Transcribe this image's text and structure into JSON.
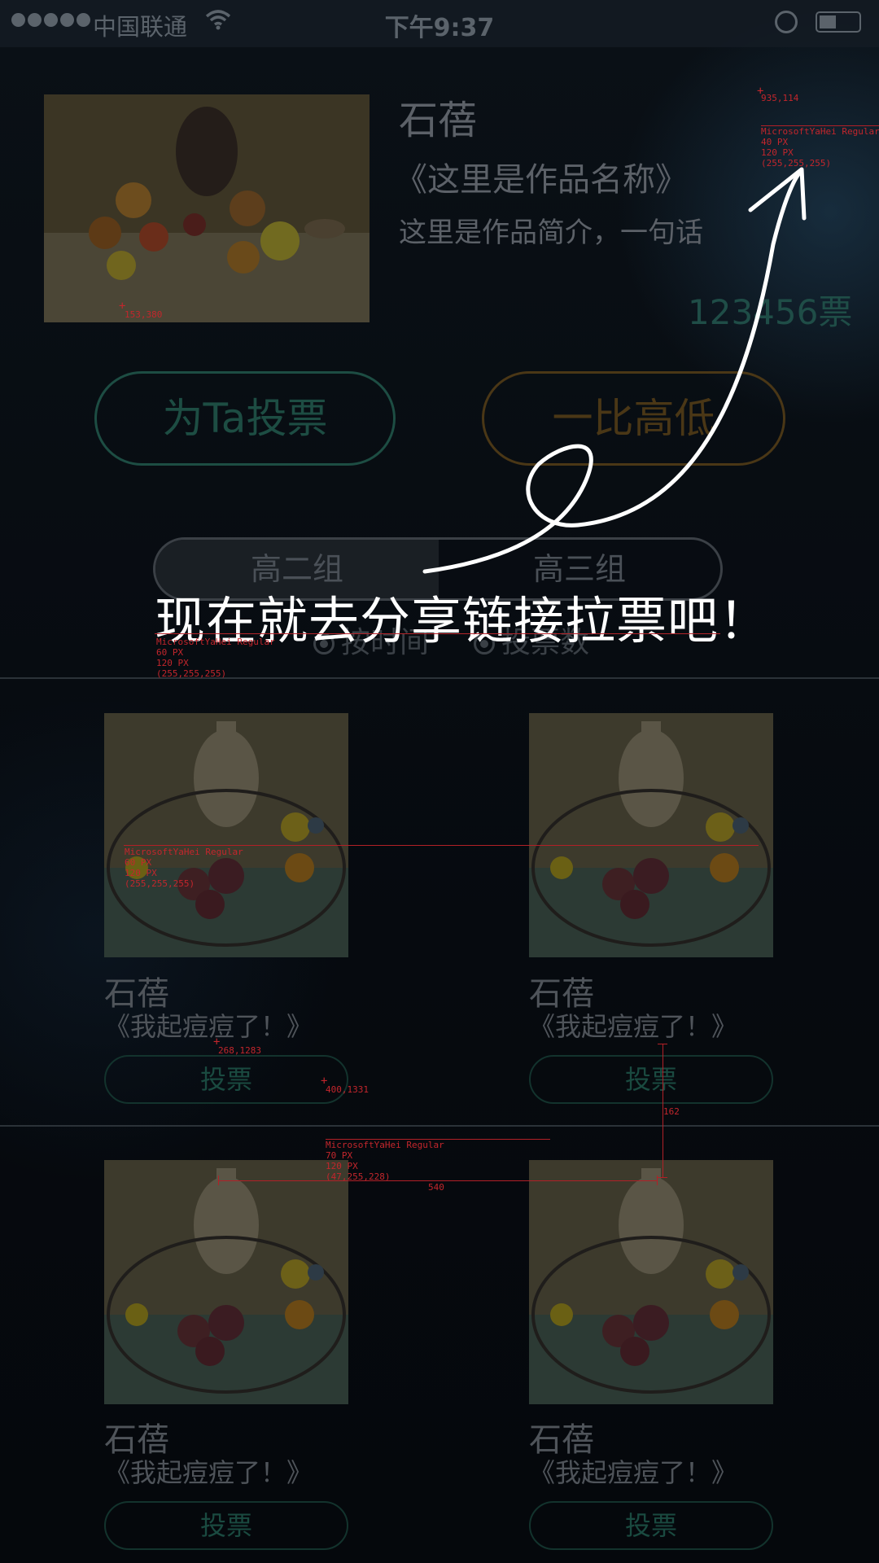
{
  "status_bar": {
    "carrier": "中国联通",
    "time": "下午9:37"
  },
  "featured": {
    "artist": "石蓓",
    "work_title": "《这里是作品名称》",
    "description": "这里是作品简介，一句话",
    "votes": "123456票",
    "vote_button": "为Ta投票",
    "compare_button": "一比高低"
  },
  "groups": {
    "left": "高二组",
    "right": "高三组"
  },
  "sort": {
    "by_time": "按时间",
    "by_votes": "投票数"
  },
  "cards": [
    {
      "artist": "石蓓",
      "work": "《我起痘痘了！》",
      "button": "投票"
    },
    {
      "artist": "石蓓",
      "work": "《我起痘痘了！》",
      "button": "投票"
    },
    {
      "artist": "石蓓",
      "work": "《我起痘痘了！》",
      "button": "投票"
    },
    {
      "artist": "石蓓",
      "work": "《我起痘痘了！》",
      "button": "投票"
    }
  ],
  "overlay": {
    "share_prompt": "现在就去分享链接拉票吧！"
  },
  "annotations": {
    "coord_1": "935,114",
    "font_1": [
      "MicrosoftYaHei Regular",
      "40 PX",
      "120 PX",
      "(255,255,255)"
    ],
    "coord_2": "153,380",
    "font_2": [
      "MicrosoftYaHei Regular",
      "60 PX",
      "120 PX",
      "(255,255,255)"
    ],
    "font_3": [
      "MicrosoftYaHei Regular",
      "60 PX",
      "120 PX",
      "(255,255,255)"
    ],
    "coord_3": "268,1283",
    "coord_4": "400,1331",
    "font_4": [
      "MicrosoftYaHei Regular",
      "70 PX",
      "120 PX",
      "(47,255,228)"
    ],
    "measure_1": "162",
    "measure_2": "540"
  }
}
